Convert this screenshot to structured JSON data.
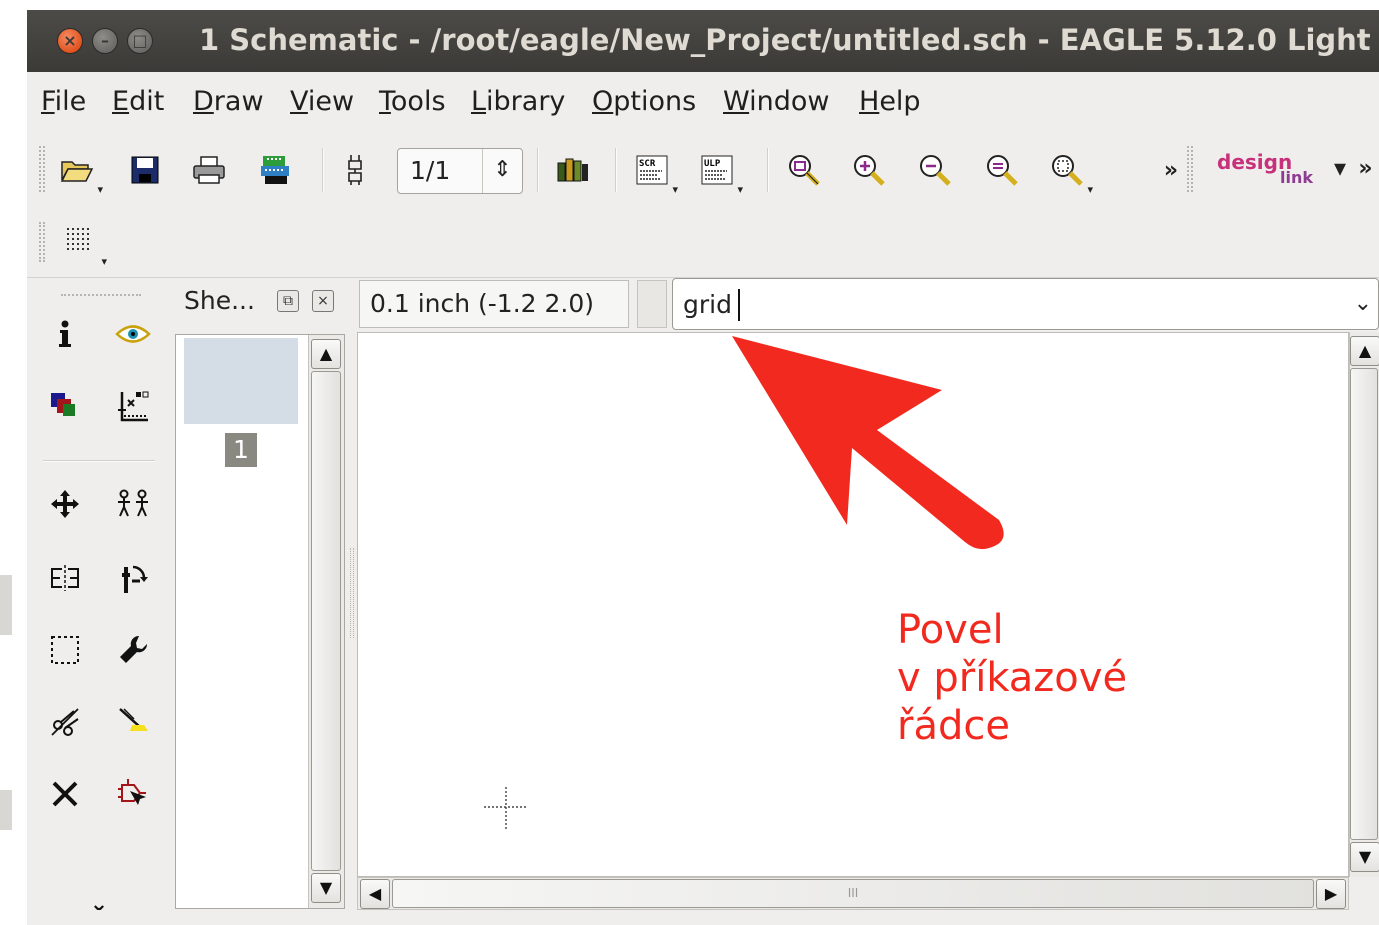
{
  "window": {
    "title": "1 Schematic - /root/eagle/New_Project/untitled.sch - EAGLE 5.12.0 Light",
    "close_glyph": "×",
    "minimize_glyph": "–",
    "maximize_glyph": "□"
  },
  "menubar": [
    {
      "label": "File",
      "mnemonic": "F",
      "rest": "ile"
    },
    {
      "label": "Edit",
      "mnemonic": "E",
      "rest": "dit"
    },
    {
      "label": "Draw",
      "mnemonic": "D",
      "rest": "raw"
    },
    {
      "label": "View",
      "mnemonic": "V",
      "rest": "iew"
    },
    {
      "label": "Tools",
      "mnemonic": "T",
      "rest": "ools"
    },
    {
      "label": "Library",
      "mnemonic": "L",
      "rest": "ibrary"
    },
    {
      "label": "Options",
      "mnemonic": "O",
      "rest": "ptions"
    },
    {
      "label": "Window",
      "mnemonic": "W",
      "rest": "indow"
    },
    {
      "label": "Help",
      "mnemonic": "H",
      "rest": "elp"
    }
  ],
  "toolbar": {
    "sheet_select": "1/1",
    "spin_glyph": "⇕",
    "more_glyph": "»",
    "designlink_top": "design",
    "designlink_bottom": "link",
    "dropdown_glyph": "▾",
    "overflow_glyph": "»",
    "icons": [
      "open-icon",
      "save-icon",
      "print-icon",
      "cam-icon",
      "layer-board-icon",
      "library-use-icon",
      "script-icon",
      "ulp-icon",
      "zoom-fit-icon",
      "zoom-in-icon",
      "zoom-out-icon",
      "zoom-redraw-icon",
      "zoom-select-icon"
    ]
  },
  "toolbar2": {
    "grid_icon": "grid-icon"
  },
  "sheets_panel": {
    "title": "She...",
    "float_glyph": "⧉",
    "close_glyph": "×",
    "sheet_number": "1",
    "up_glyph": "▲",
    "down_glyph": "▼"
  },
  "toolbox": {
    "more_glyph": "⌄",
    "tools": [
      "info",
      "show",
      "display-layers",
      "mark",
      "move",
      "copy",
      "mirror",
      "rotate",
      "group",
      "change",
      "cut",
      "paste",
      "delete",
      "add"
    ]
  },
  "editor": {
    "coordinates": "0.1 inch (-1.2 2.0)",
    "command": "grid",
    "cmd_dropdown_glyph": "⌄",
    "left_glyph": "◀",
    "right_glyph": "▶",
    "up_glyph": "▲",
    "down_glyph": "▼",
    "hscroll_grip": "III"
  },
  "annotation": {
    "line1": "Povel",
    "line2": "v příkazové",
    "line3": "řádce",
    "color": "#f2291f"
  }
}
